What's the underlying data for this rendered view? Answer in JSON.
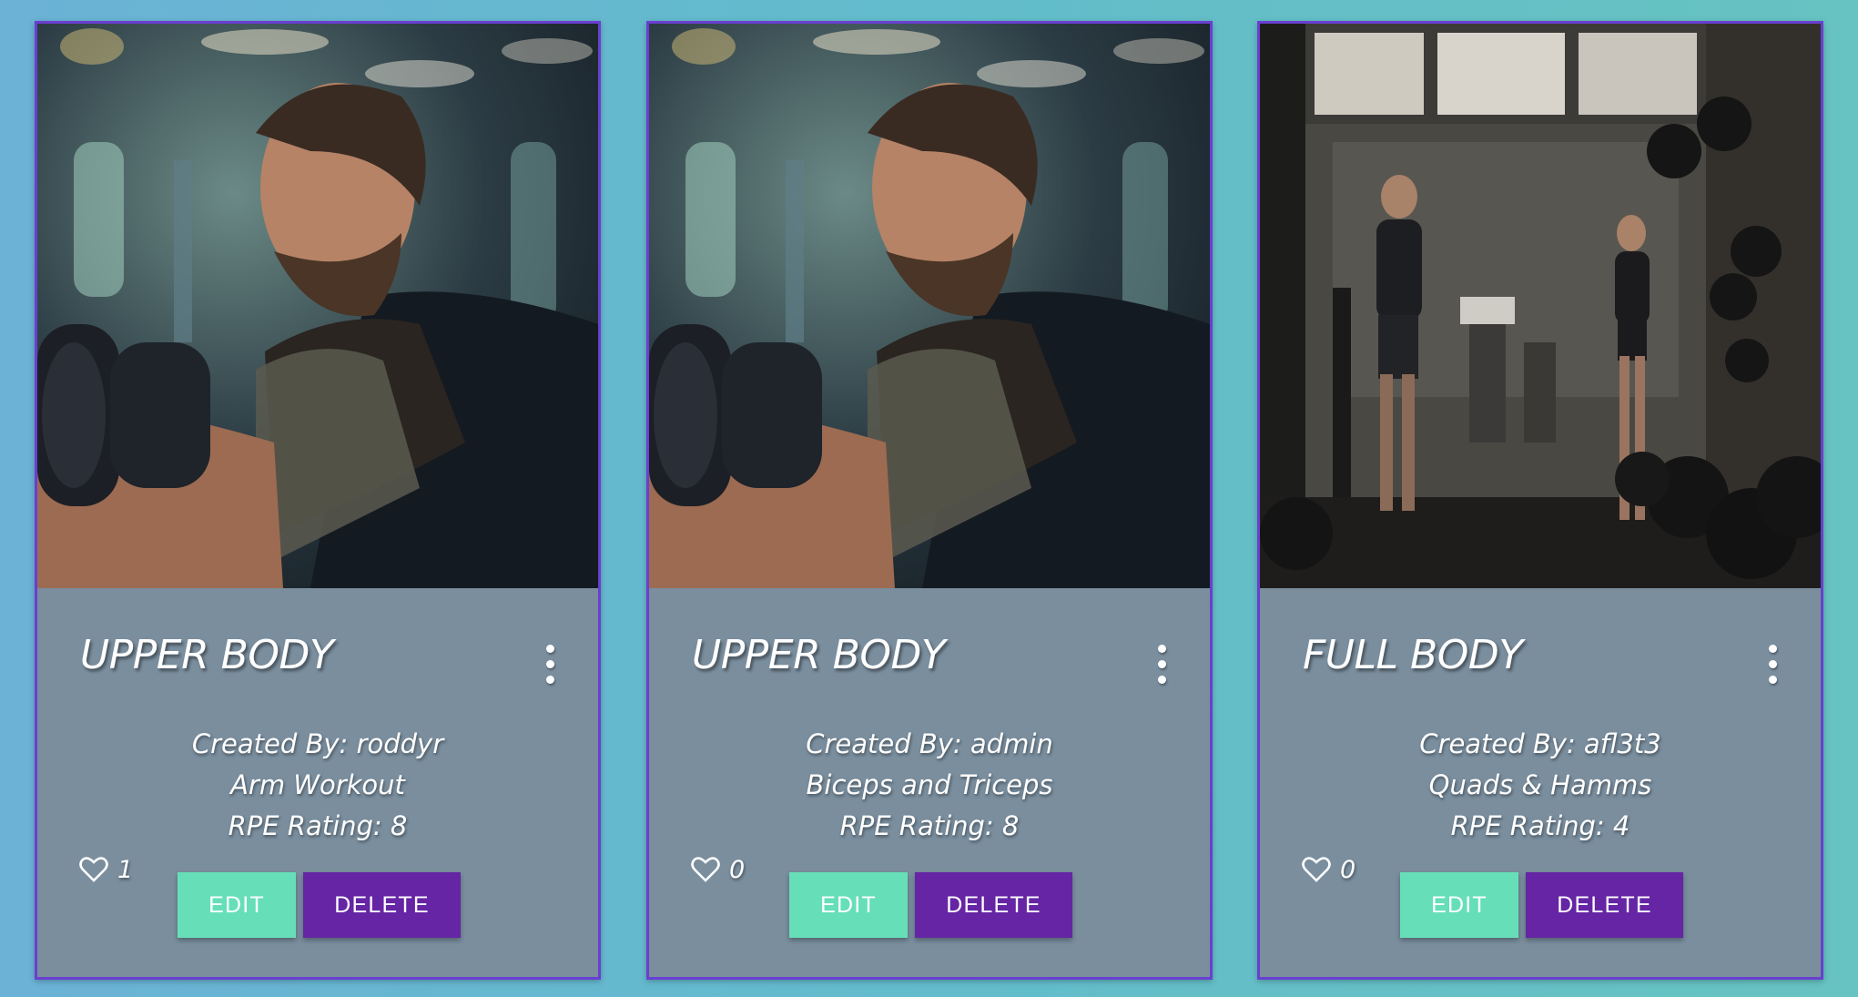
{
  "colors": {
    "card_border": "#6a3fd0",
    "card_body": "#7a8e9e",
    "edit_button": "#66dfb8",
    "delete_button": "#6525a4"
  },
  "cards": [
    {
      "image": "man-lifting-dumbbell-photo",
      "title": "UPPER BODY",
      "created_by": "Created By: roddyr",
      "workout_name": "Arm Workout",
      "rpe": "RPE Rating: 8",
      "likes": "1",
      "edit_label": "EDIT",
      "delete_label": "DELETE",
      "menu_icon": "more-vert-icon"
    },
    {
      "image": "man-lifting-dumbbell-photo",
      "title": "UPPER BODY",
      "created_by": "Created By: admin",
      "workout_name": "Biceps and Triceps",
      "rpe": "RPE Rating: 8",
      "likes": "0",
      "edit_label": "EDIT",
      "delete_label": "DELETE",
      "menu_icon": "more-vert-icon"
    },
    {
      "image": "gym-interior-photo",
      "title": "FULL BODY",
      "created_by": "Created By: afl3t3",
      "workout_name": "Quads & Hamms",
      "rpe": "RPE Rating: 4",
      "likes": "0",
      "edit_label": "EDIT",
      "delete_label": "DELETE",
      "menu_icon": "more-vert-icon"
    }
  ]
}
